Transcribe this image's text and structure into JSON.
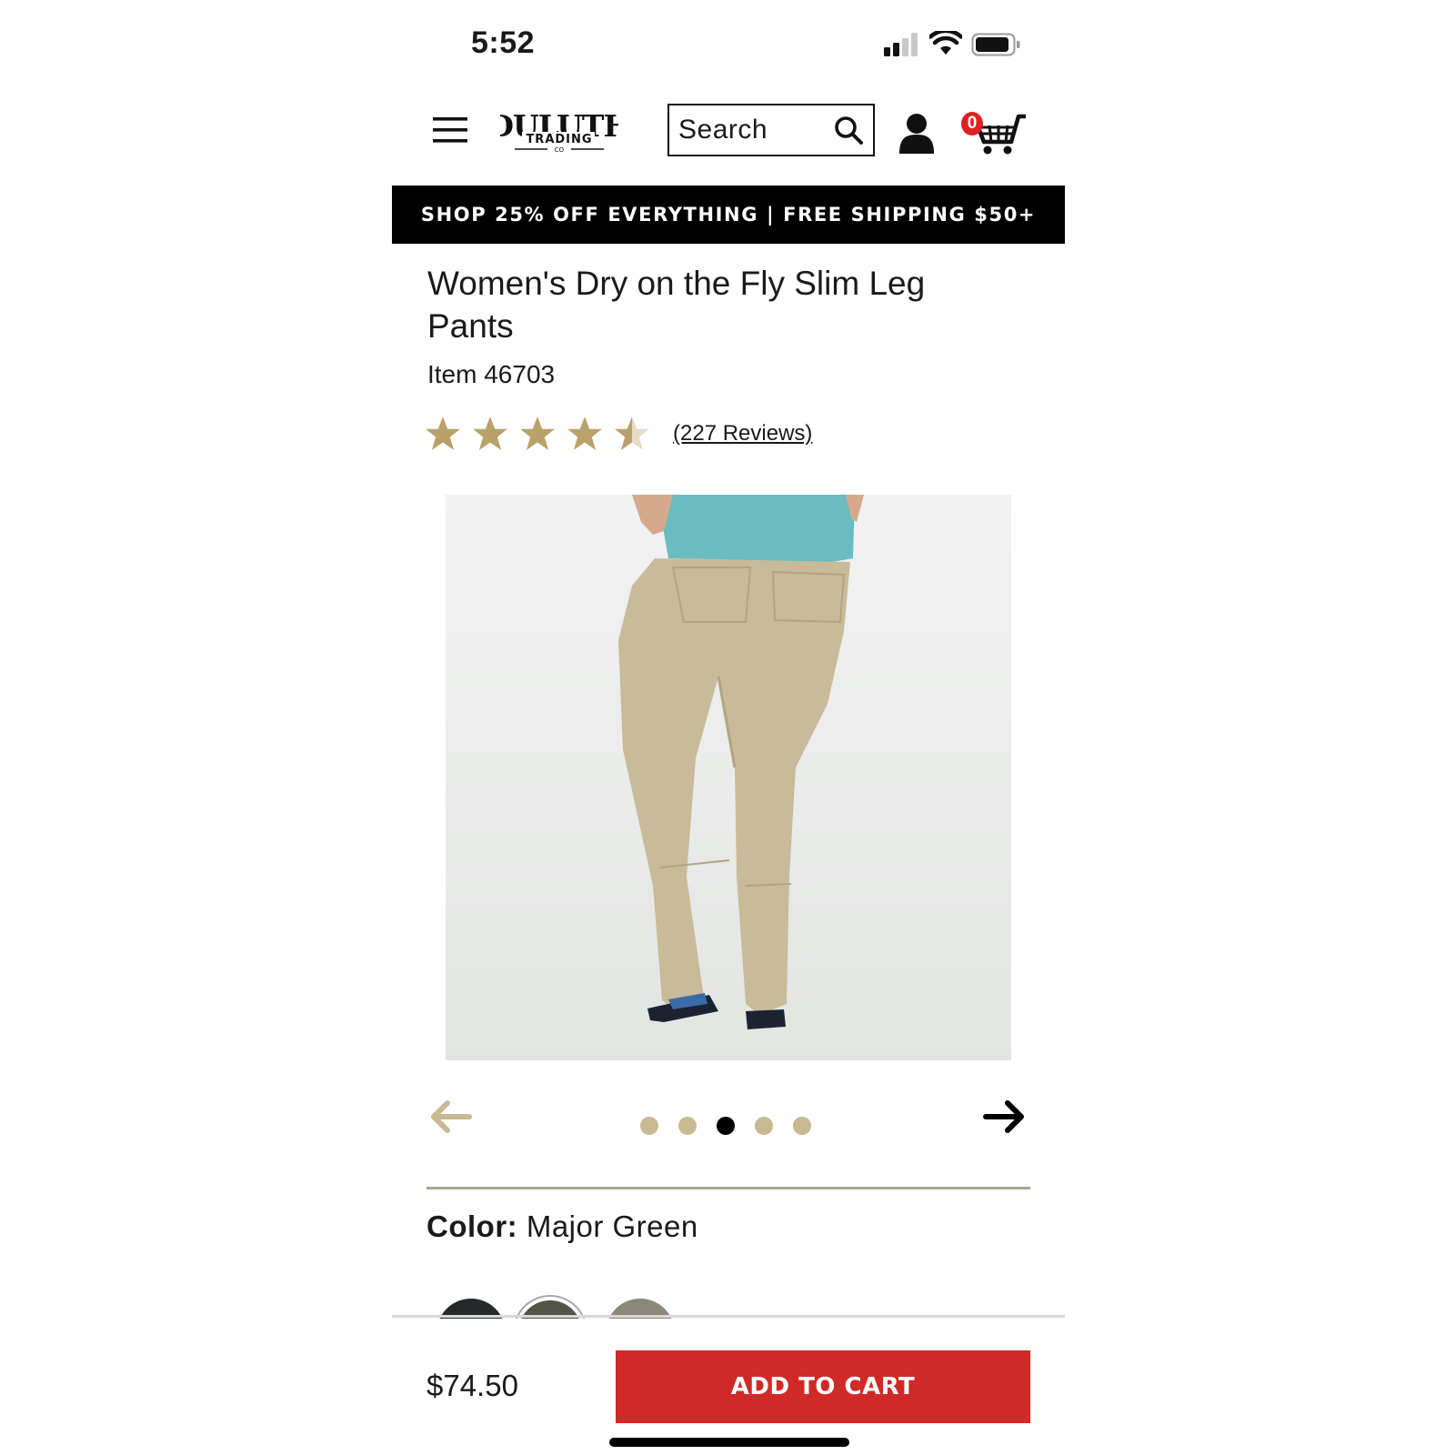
{
  "status_bar": {
    "time": "5:52"
  },
  "header": {
    "search": {
      "placeholder": "Search"
    },
    "cart_count": "0",
    "logo_text": "DULUTH TRADING CO"
  },
  "promo_banner": "SHOP 25% OFF EVERYTHING | FREE SHIPPING $50+",
  "product": {
    "title": "Women's Dry on the Fly Slim Leg Pants",
    "item_number": "Item 46703",
    "rating": {
      "stars": 4.5,
      "max": 5,
      "reviews_text": "(227 Reviews)"
    },
    "carousel": {
      "slides": 5,
      "active_slide": 3
    },
    "color": {
      "label": "Color:",
      "value": "Major Green"
    },
    "swatches": [
      "#25292a",
      "#525446",
      "#8d877a"
    ],
    "price": "$74.50"
  },
  "actions": {
    "add_to_cart": "ADD TO CART"
  },
  "colors": {
    "star": "#b9a16b",
    "promo_bg": "#000000",
    "cta": "#cf2a27",
    "dot": "#c9b993"
  }
}
